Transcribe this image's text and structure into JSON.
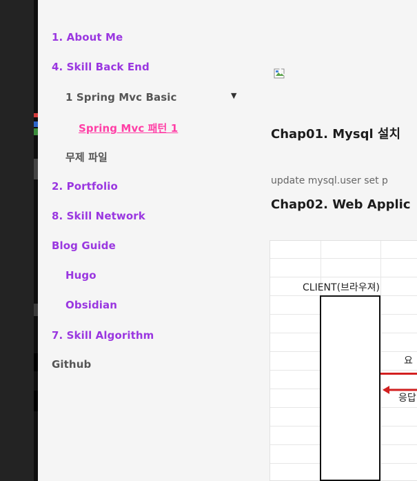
{
  "sidebar": {
    "items": [
      {
        "label": "1. About Me"
      },
      {
        "label": "4. Skill Back End"
      },
      {
        "label": "1 Spring Mvc Basic"
      },
      {
        "label": "Spring Mvc 패턴 1"
      },
      {
        "label": "무제 파일"
      },
      {
        "label": "2. Portfolio"
      },
      {
        "label": "8. Skill Network"
      },
      {
        "label": "Blog Guide"
      },
      {
        "label": "Hugo"
      },
      {
        "label": "Obsidian"
      },
      {
        "label": "7. Skill Algorithm"
      },
      {
        "label": "Github"
      }
    ],
    "chevron": "▼"
  },
  "main": {
    "chapter1": "Chap01. Mysql 설치",
    "update_line": "update mysql.user set p",
    "chapter2": "Chap02. Web Applic"
  },
  "diagram": {
    "client_label": "CLIENT(브라우져)",
    "request_label": "요",
    "response_label": "응답"
  },
  "colors": {
    "link": "#9a37e0",
    "active": "#ff3fa6",
    "arrow": "#d32020"
  },
  "icons": [
    "broken-image-icon",
    "chevron-down-icon",
    "left-arrow-icon"
  ]
}
